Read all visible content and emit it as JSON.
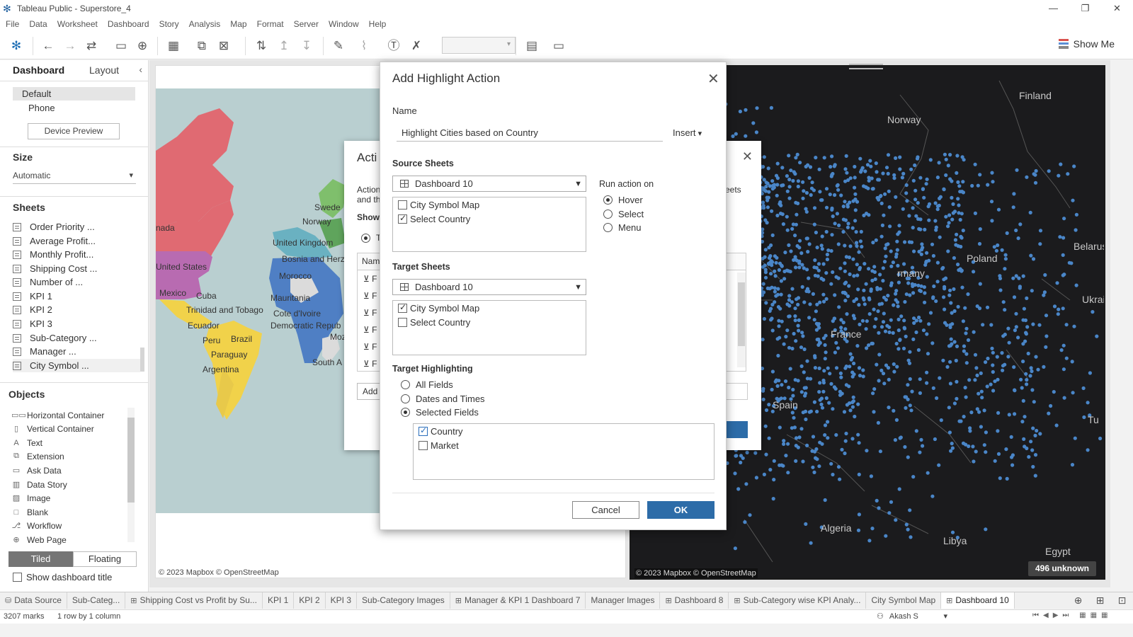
{
  "window": {
    "title": "Tableau Public - Superstore_4",
    "controls": [
      "—",
      "❐",
      "✕"
    ]
  },
  "menu": [
    "File",
    "Data",
    "Worksheet",
    "Dashboard",
    "Story",
    "Analysis",
    "Map",
    "Format",
    "Server",
    "Window",
    "Help"
  ],
  "toolbar": {
    "show_me": "Show Me"
  },
  "left_pane": {
    "tabs": [
      "Dashboard",
      "Layout"
    ],
    "devices": [
      "Default",
      "Phone"
    ],
    "device_preview": "Device Preview",
    "size_title": "Size",
    "size_value": "Automatic",
    "sheets_title": "Sheets",
    "sheets": [
      "Order Priority ...",
      "Average Profit...",
      "Monthly Profit...",
      "Shipping Cost ...",
      "Number of ...",
      "KPI 1",
      "KPI 2",
      "KPI 3",
      "Sub-Category ...",
      "Manager ...",
      "City Symbol ..."
    ],
    "objects_title": "Objects",
    "objects": [
      {
        "label": "Horizontal Container",
        "icon": "horizontal-container-icon"
      },
      {
        "label": "Vertical Container",
        "icon": "vertical-container-icon"
      },
      {
        "label": "Text",
        "icon": "text-icon"
      },
      {
        "label": "Extension",
        "icon": "extension-icon"
      },
      {
        "label": "Ask Data",
        "icon": "ask-data-icon"
      },
      {
        "label": "Data Story",
        "icon": "data-story-icon"
      },
      {
        "label": "Image",
        "icon": "image-icon"
      },
      {
        "label": "Blank",
        "icon": "blank-icon"
      },
      {
        "label": "Workflow",
        "icon": "workflow-icon"
      },
      {
        "label": "Web Page",
        "icon": "web-page-icon"
      }
    ],
    "tiled": "Tiled",
    "floating": "Floating",
    "show_title": "Show dashboard title"
  },
  "left_map": {
    "labels": [
      "nada",
      "United States",
      "Mexico",
      "Cuba",
      "Trinidad and Tobago",
      "Ecuador",
      "Peru",
      "Brazil",
      "Paraguay",
      "Argentina",
      "Swede",
      "Norway",
      "United Kingdom",
      "Bosnia and Herz",
      "Morocco",
      "Mauritania",
      "Cote d'Ivoire",
      "Democratic Repub",
      "South A",
      "Moz"
    ],
    "credit": "© 2023 Mapbox © OpenStreetMap"
  },
  "right_map": {
    "labels": [
      "Finland",
      "Norway",
      "Belarus",
      "Poland",
      "rmany",
      "Ukrain",
      "France",
      "Spain",
      "Tu",
      "Algeria",
      "Libya",
      "Egypt"
    ],
    "credit": "© 2023 Mapbox © OpenStreetMap",
    "unknown": "496 unknown",
    "dot_color": "#4a86c8"
  },
  "actions_dialog": {
    "title": "Acti",
    "frag_lines": [
      "Action",
      "and th"
    ],
    "show": "Show",
    "radio_frag": "T",
    "col_header": "Nam",
    "rows": [
      "F",
      "F",
      "F",
      "F",
      "F",
      "F"
    ],
    "add": "Add",
    "right_frag": "eets",
    "right_frag2": "e"
  },
  "highlight_dialog": {
    "title": "Add Highlight Action",
    "name_label": "Name",
    "name_value": "Highlight Cities based on Country",
    "insert": "Insert",
    "source_label": "Source Sheets",
    "source_dropdown": "Dashboard 10",
    "source_items": [
      {
        "label": "City Symbol Map",
        "checked": false
      },
      {
        "label": "Select Country",
        "checked": true
      }
    ],
    "run_action_label": "Run action on",
    "run_options": [
      {
        "label": "Hover",
        "checked": true
      },
      {
        "label": "Select",
        "checked": false
      },
      {
        "label": "Menu",
        "checked": false
      }
    ],
    "target_label": "Target Sheets",
    "target_dropdown": "Dashboard 10",
    "target_items": [
      {
        "label": "City Symbol Map",
        "checked": true
      },
      {
        "label": "Select Country",
        "checked": false
      }
    ],
    "highlighting_label": "Target Highlighting",
    "highlighting_options": [
      {
        "label": "All Fields",
        "checked": false
      },
      {
        "label": "Dates and Times",
        "checked": false
      },
      {
        "label": "Selected Fields",
        "checked": true
      }
    ],
    "fields": [
      {
        "label": "Country",
        "checked": true
      },
      {
        "label": "Market",
        "checked": false
      }
    ],
    "cancel": "Cancel",
    "ok": "OK",
    "accent": "#2d6ca8"
  },
  "tabs": [
    {
      "label": "Data Source",
      "icon": "data-source-icon"
    },
    {
      "label": "Sub-Categ...",
      "icon": ""
    },
    {
      "label": "Shipping Cost vs Profit by Su...",
      "icon": "dashboard-icon"
    },
    {
      "label": "KPI 1",
      "icon": ""
    },
    {
      "label": "KPI 2",
      "icon": ""
    },
    {
      "label": "KPI 3",
      "icon": ""
    },
    {
      "label": "Sub-Category Images",
      "icon": ""
    },
    {
      "label": "Manager & KPI 1 Dashboard 7",
      "icon": "dashboard-icon"
    },
    {
      "label": "Manager Images",
      "icon": ""
    },
    {
      "label": "Dashboard 8",
      "icon": "dashboard-icon"
    },
    {
      "label": "Sub-Category wise KPI Analy...",
      "icon": "dashboard-icon"
    },
    {
      "label": "City Symbol Map",
      "icon": ""
    },
    {
      "label": "Dashboard 10",
      "icon": "dashboard-icon"
    }
  ],
  "status": {
    "marks": "3207 marks",
    "layout": "1 row by 1 column",
    "user": "Akash S"
  }
}
